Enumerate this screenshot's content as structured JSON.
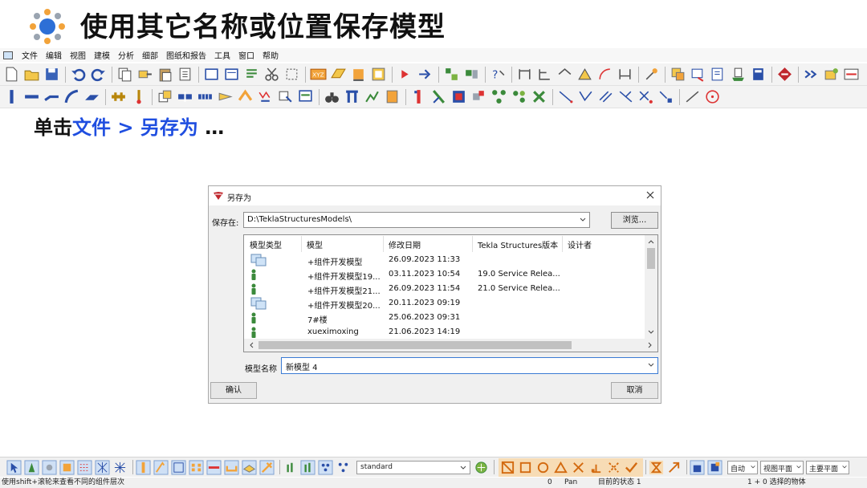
{
  "slide": {
    "title": "使用其它名称或位置保存模型",
    "instruction_prefix": "单击",
    "instruction_menu": "文件",
    "instruction_sep": ">",
    "instruction_item": "另存为",
    "instruction_suffix": "…",
    "accent_color": "#1f4ee0"
  },
  "menubar": {
    "items": [
      "文件",
      "编辑",
      "视图",
      "建模",
      "分析",
      "细部",
      "图纸和报告",
      "工具",
      "窗口",
      "帮助"
    ]
  },
  "dialog": {
    "title": "另存为",
    "save_in_label": "保存在:",
    "save_in_path": "D:\\TeklaStructuresModels\\",
    "browse_label": "浏览...",
    "columns": [
      "模型类型",
      "模型",
      "修改日期",
      "Tekla Structures版本",
      "设计者"
    ],
    "rows": [
      {
        "type_icon": "multi-user-model-icon",
        "name": "+组件开发模型",
        "date": "26.09.2023 11:33",
        "version": ""
      },
      {
        "type_icon": "single-user-model-icon",
        "name": "+组件开发模型19...",
        "date": "03.11.2023 10:54",
        "version": "19.0 Service Relea..."
      },
      {
        "type_icon": "single-user-model-icon",
        "name": "+组件开发模型21...",
        "date": "26.09.2023 11:54",
        "version": "21.0 Service Relea..."
      },
      {
        "type_icon": "multi-user-model-icon",
        "name": "+组件开发模型20...",
        "date": "20.11.2023 09:19",
        "version": ""
      },
      {
        "type_icon": "single-user-model-icon",
        "name": "7#楼",
        "date": "25.06.2023 09:31",
        "version": ""
      },
      {
        "type_icon": "single-user-model-icon",
        "name": "xueximoxing",
        "date": "21.06.2023 14:19",
        "version": ""
      }
    ],
    "model_name_label": "模型名称",
    "model_name_value": "新模型 4",
    "ok_label": "确认",
    "cancel_label": "取消"
  },
  "bottom_toolbar": {
    "phase_select": "standard",
    "snap_mode": "自动",
    "view_plane": "视图平面",
    "work_plane": "主要平面"
  },
  "statusbar": {
    "hint": "使用shift+滚轮来查看不同的组件层次",
    "count": "0",
    "mode": "Pan",
    "state_label": "目前的状态 1",
    "selection": "1 + 0 选择的物体"
  }
}
